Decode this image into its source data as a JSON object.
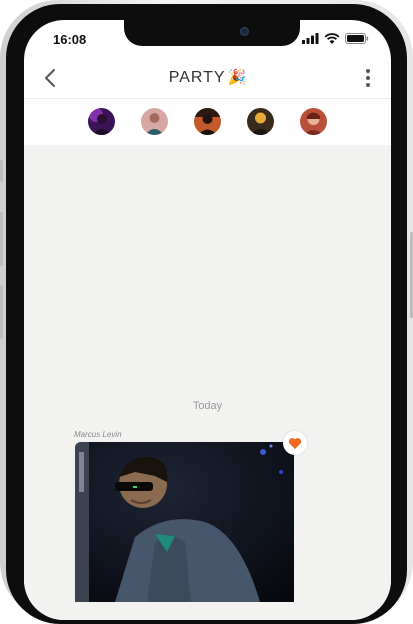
{
  "status_bar": {
    "time": "16:08",
    "icons": [
      "signal-icon",
      "wifi-icon",
      "battery-icon"
    ]
  },
  "header": {
    "title": "PARTY",
    "title_emoji": "🎉",
    "back_icon": "chevron-left-icon",
    "more_icon": "more-vertical-icon"
  },
  "participants": [
    {
      "avatar_color": "#6a2b8c"
    },
    {
      "avatar_color": "#c98a86"
    },
    {
      "avatar_color": "#b8532f"
    },
    {
      "avatar_color": "#e0a23c"
    },
    {
      "avatar_color": "#a33d2c"
    }
  ],
  "chat": {
    "date_separator": "Today",
    "messages": [
      {
        "sender": "Marcus Levin",
        "type": "photo",
        "reaction": "heart"
      }
    ]
  },
  "colors": {
    "chat_background": "#f2f2f1",
    "reaction_heart": "#f06a1e",
    "title_text": "#333333"
  }
}
